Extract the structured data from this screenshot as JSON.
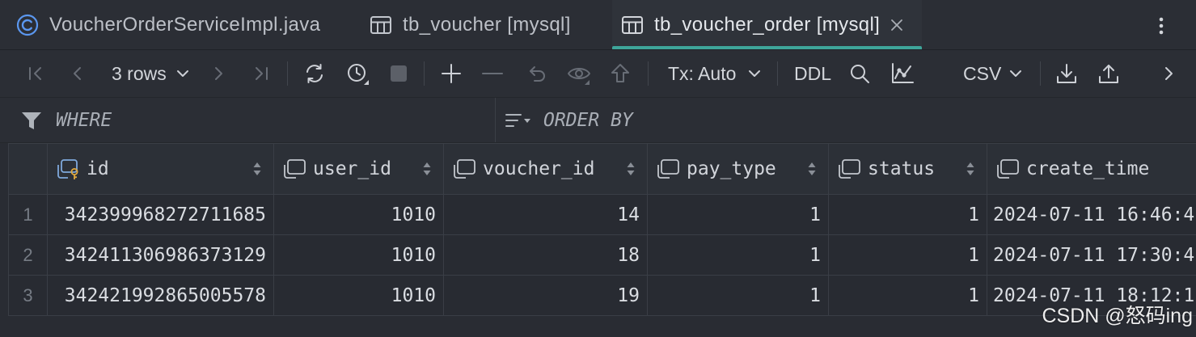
{
  "tabs": [
    {
      "label": "VoucherOrderServiceImpl.java",
      "icon": "java-class-icon",
      "active": false
    },
    {
      "label": "tb_voucher [mysql]",
      "icon": "table-icon",
      "active": false
    },
    {
      "label": "tb_voucher_order [mysql]",
      "icon": "table-icon",
      "active": true,
      "closable": true
    }
  ],
  "toolbar": {
    "rows_label": "3 rows",
    "transaction_mode": "Tx: Auto",
    "ddl_label": "DDL",
    "export_format": "CSV",
    "buttons": [
      {
        "icon": "first-page-icon",
        "enabled": false
      },
      {
        "icon": "previous-page-icon",
        "enabled": false
      },
      {
        "icon": "next-page-icon",
        "enabled": false
      },
      {
        "icon": "last-page-icon",
        "enabled": false
      },
      {
        "icon": "refresh-icon",
        "enabled": true
      },
      {
        "icon": "history-icon",
        "enabled": true
      },
      {
        "icon": "stop-icon",
        "enabled": false
      },
      {
        "icon": "add-row-icon",
        "enabled": true
      },
      {
        "icon": "delete-row-icon",
        "enabled": false
      },
      {
        "icon": "revert-icon",
        "enabled": false
      },
      {
        "icon": "preview-changes-icon",
        "enabled": false
      },
      {
        "icon": "submit-icon",
        "enabled": false
      },
      {
        "icon": "search-icon",
        "enabled": true
      },
      {
        "icon": "chart-icon",
        "enabled": true
      },
      {
        "icon": "download-icon",
        "enabled": true
      },
      {
        "icon": "upload-icon",
        "enabled": true
      },
      {
        "icon": "more-icon",
        "enabled": true
      }
    ]
  },
  "filter": {
    "where_placeholder": "WHERE",
    "order_by_placeholder": "ORDER BY"
  },
  "grid": {
    "columns": [
      {
        "name": "id",
        "icon": "primary-key-column-icon"
      },
      {
        "name": "user_id",
        "icon": "column-icon"
      },
      {
        "name": "voucher_id",
        "icon": "column-icon"
      },
      {
        "name": "pay_type",
        "icon": "column-icon"
      },
      {
        "name": "status",
        "icon": "column-icon"
      },
      {
        "name": "create_time",
        "icon": "column-icon"
      }
    ],
    "rows": [
      {
        "num": "1",
        "cells": [
          "342399968272711685",
          "1010",
          "14",
          "1",
          "1",
          "2024-07-11 16:46:4"
        ]
      },
      {
        "num": "2",
        "cells": [
          "342411306986373129",
          "1010",
          "18",
          "1",
          "1",
          "2024-07-11 17:30:4"
        ]
      },
      {
        "num": "3",
        "cells": [
          "342421992865005578",
          "1010",
          "19",
          "1",
          "1",
          "2024-07-11 18:12:1"
        ]
      }
    ]
  },
  "watermark": "CSDN @怒码ing",
  "colors": {
    "accent": "#3ea59a",
    "java_class_icon": "#5b97ef",
    "primary_key_icon": "#e0a83e",
    "grid_background": "#282b32"
  }
}
